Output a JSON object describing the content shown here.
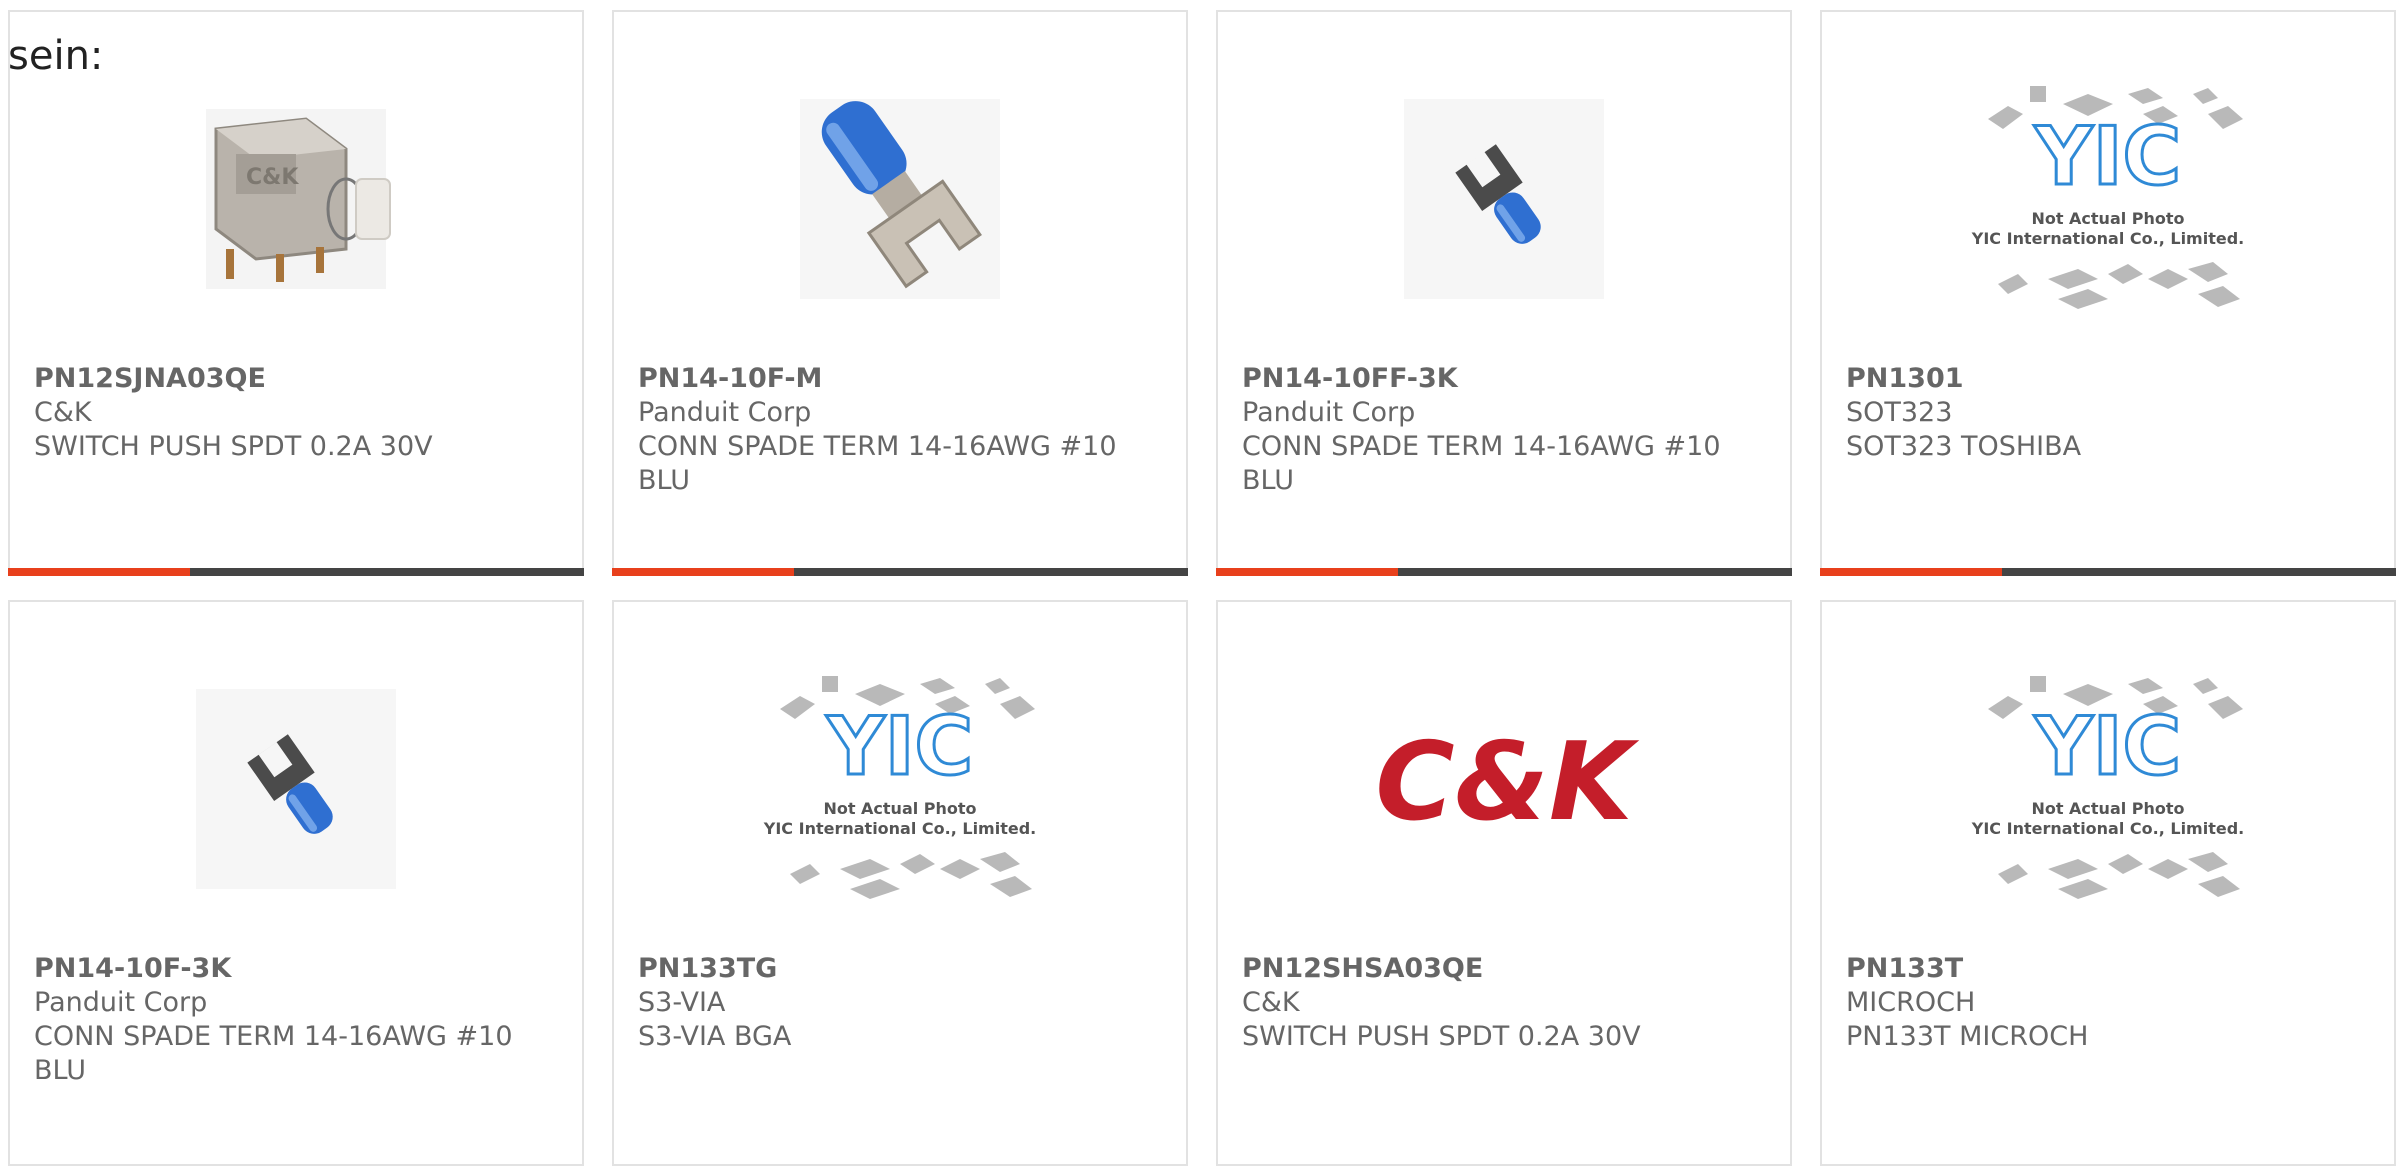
{
  "intro": {
    "text": "sein:"
  },
  "theme": {
    "accent": "#e8401c",
    "bar": "#444444",
    "text": "#666666",
    "border": "#e2e2e2"
  },
  "placeholder": {
    "logo": "YIC",
    "line1": "Not Actual Photo",
    "line2": "YIC International Co., Limited."
  },
  "brand_logo": {
    "text": "C&K",
    "color": "#c41e2a"
  },
  "products": [
    {
      "part_number": "PN12SJNA03QE",
      "manufacturer": "C&K",
      "description": "SWITCH PUSH SPDT 0.2A 30V",
      "image": "push-switch-photo"
    },
    {
      "part_number": "PN14-10F-M",
      "manufacturer": "Panduit Corp",
      "description": "CONN SPADE TERM 14-16AWG #10 BLU",
      "image": "spade-terminal-photo"
    },
    {
      "part_number": "PN14-10FF-3K",
      "manufacturer": "Panduit Corp",
      "description": "CONN SPADE TERM 14-16AWG #10 BLU",
      "image": "spade-terminal-photo"
    },
    {
      "part_number": "PN1301",
      "manufacturer": "SOT323",
      "description": "SOT323 TOSHIBA",
      "image": "placeholder-photo"
    },
    {
      "part_number": "PN14-10F-3K",
      "manufacturer": "Panduit Corp",
      "description": "CONN SPADE TERM 14-16AWG #10 BLU",
      "image": "spade-terminal-photo"
    },
    {
      "part_number": "PN133TG",
      "manufacturer": "S3-VIA",
      "description": "S3-VIA BGA",
      "image": "placeholder-photo"
    },
    {
      "part_number": "PN12SHSA03QE",
      "manufacturer": "C&K",
      "description": "SWITCH PUSH SPDT 0.2A 30V",
      "image": "brand-logo"
    },
    {
      "part_number": "PN133T",
      "manufacturer": "MICROCH",
      "description": "PN133T MICROCH",
      "image": "placeholder-photo"
    }
  ]
}
